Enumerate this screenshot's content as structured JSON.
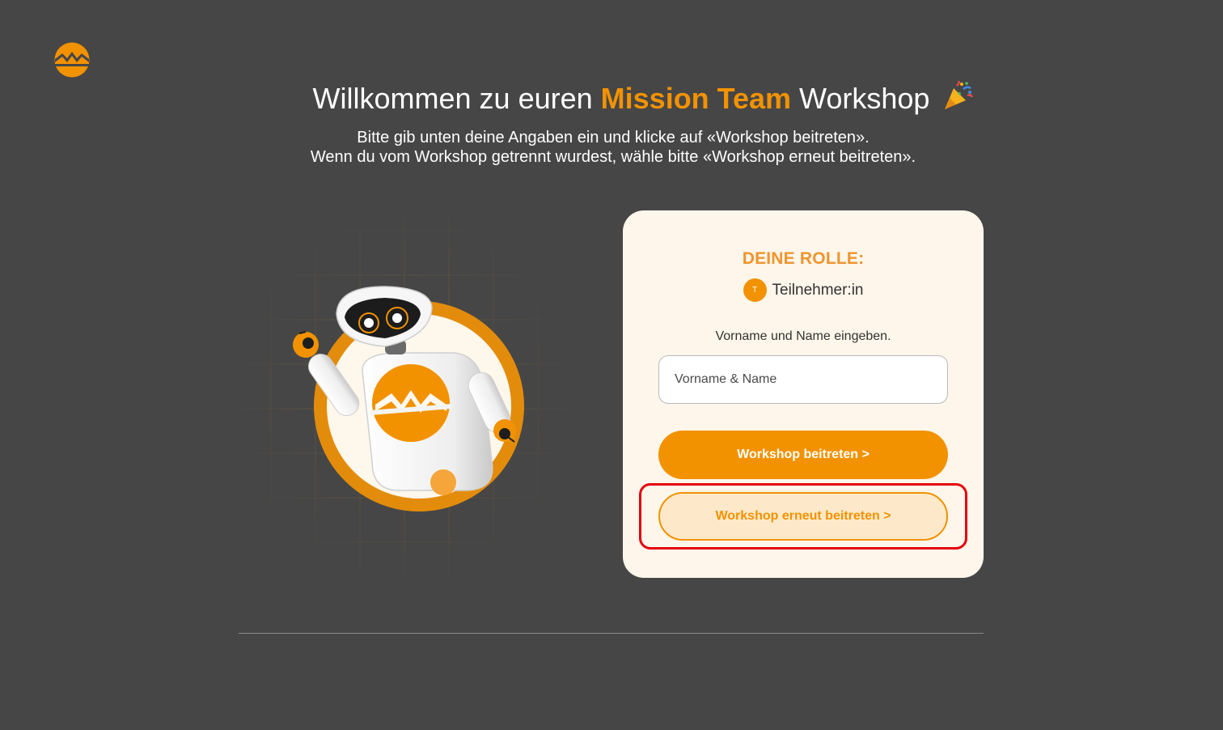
{
  "header": {
    "title_prefix": "Willkommen zu euren ",
    "title_accent": "Mission Team",
    "title_suffix": " Workshop",
    "subtitle_line1": "Bitte gib unten deine Angaben ein und klicke auf «Workshop beitreten».",
    "subtitle_line2": "Wenn du vom Workshop getrennt wurdest, wähle bitte «Workshop erneut beitreten»."
  },
  "card": {
    "role_heading": "DEINE ROLLE:",
    "role_avatar_letter": "T",
    "role_name": "Teilnehmer:in",
    "name_label": "Vorname und Name eingeben.",
    "name_input": {
      "value": "",
      "placeholder": "Vorname & Name"
    },
    "join_button": "Workshop beitreten >",
    "rejoin_button": "Workshop erneut beitreten >"
  },
  "colors": {
    "background": "#464646",
    "accent": "#f29200",
    "card_background": "#fef6ea",
    "highlight": "#e5000f"
  },
  "icons": {
    "logo": "mission-team-logo-icon",
    "party": "party-popper-icon",
    "illustration": "waving-robot-mascot"
  }
}
